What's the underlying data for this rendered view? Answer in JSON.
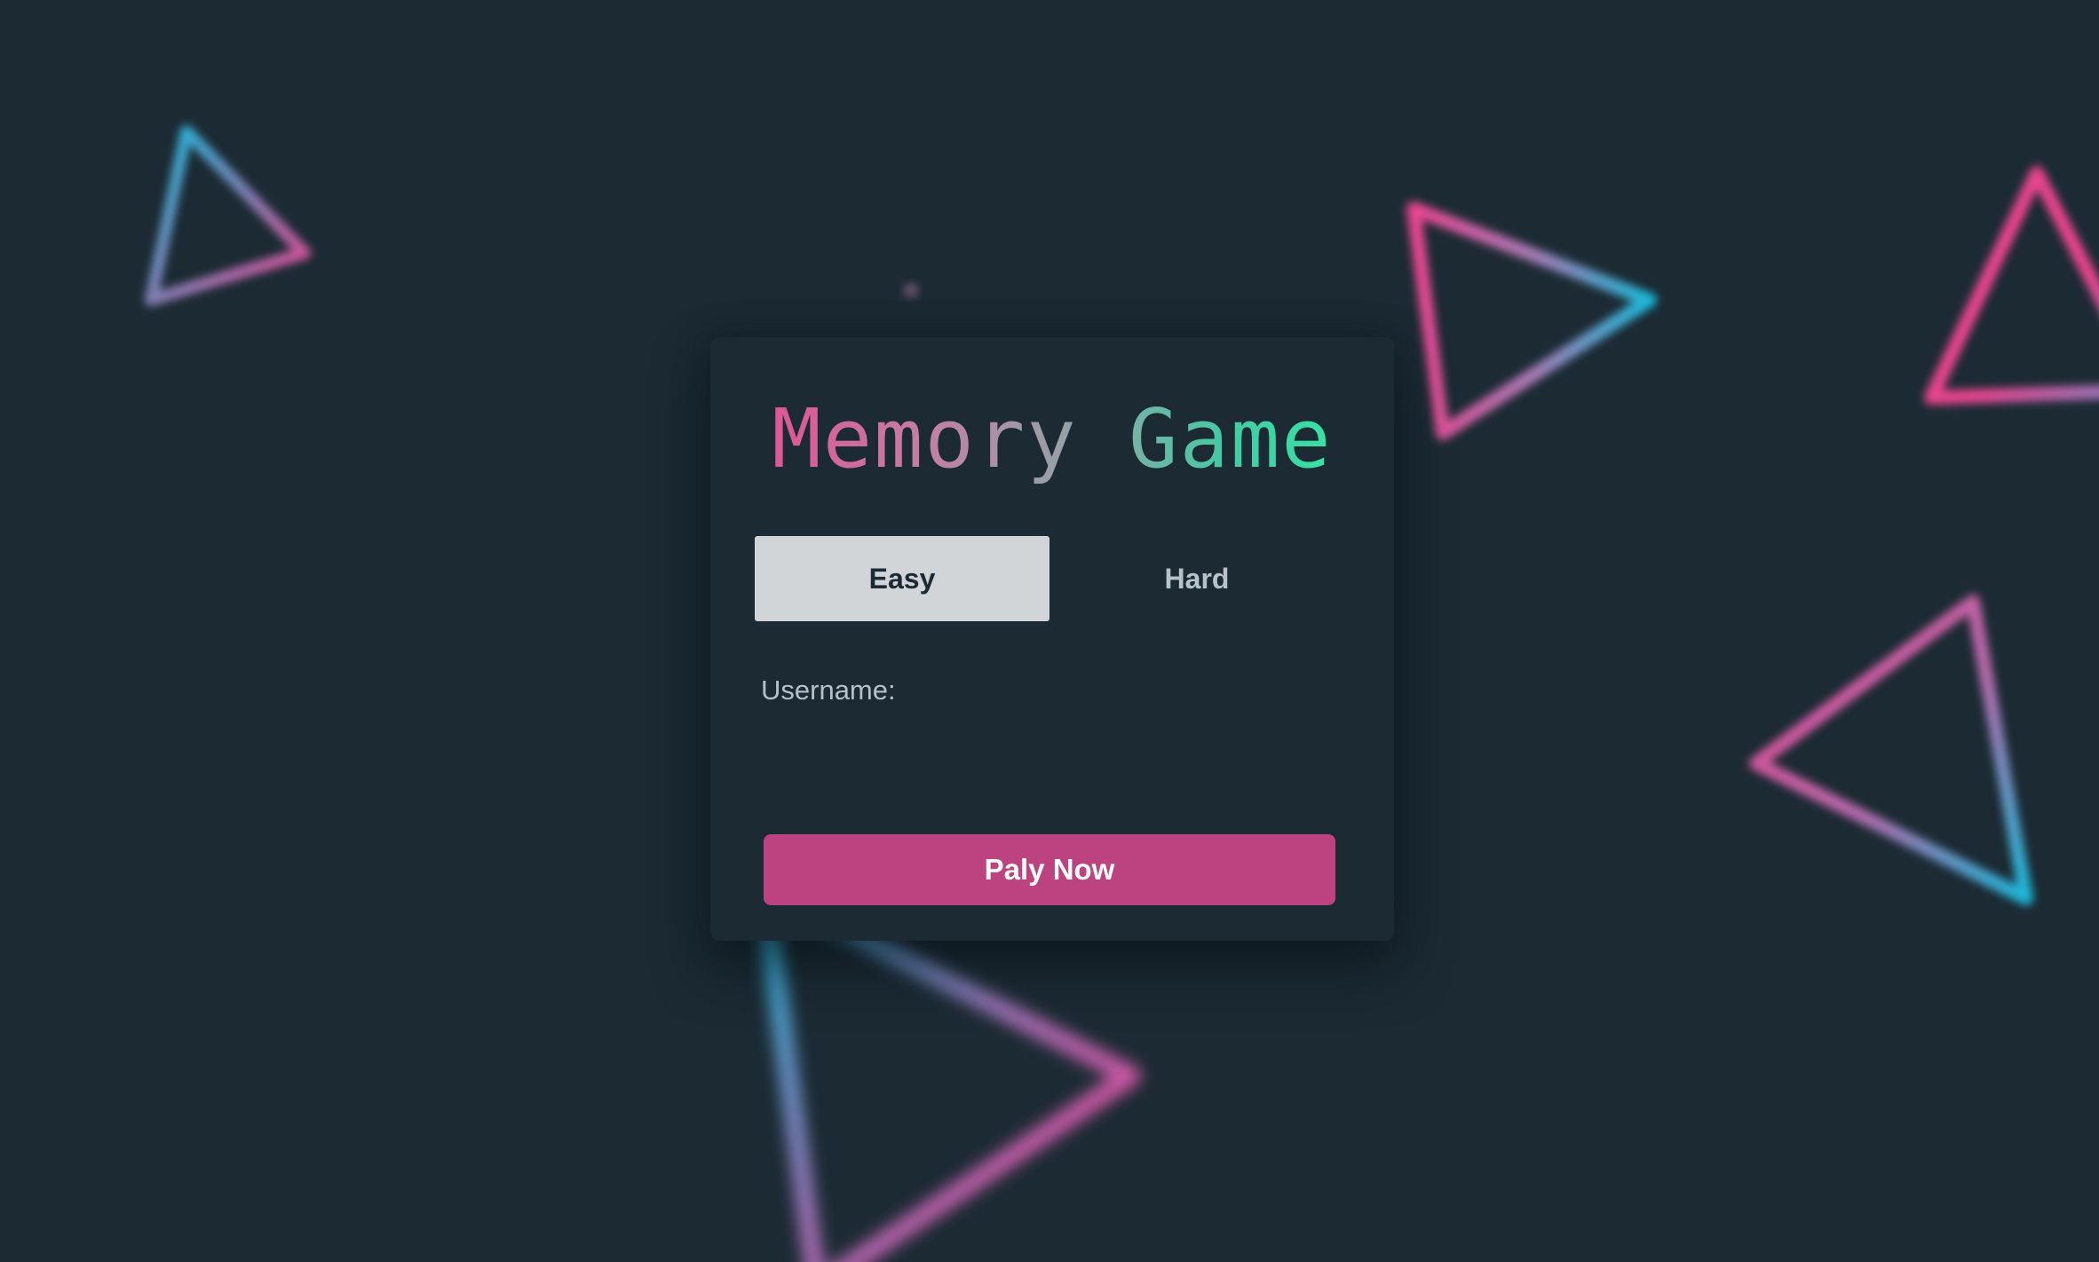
{
  "app": {
    "title": "Memory Game"
  },
  "levels": {
    "easy_label": "Easy",
    "hard_label": "Hard",
    "selected": "Easy"
  },
  "form": {
    "username_label": "Username:",
    "username_value": ""
  },
  "actions": {
    "play_label": "Paly Now"
  },
  "colors": {
    "background": "#1b2a33",
    "accent_pink": "#e8458f",
    "accent_cyan": "#1bb8d8",
    "accent_green": "#2ef0a8",
    "play_button": "#bc4280",
    "selected_level_bg": "#d1d5d8"
  }
}
